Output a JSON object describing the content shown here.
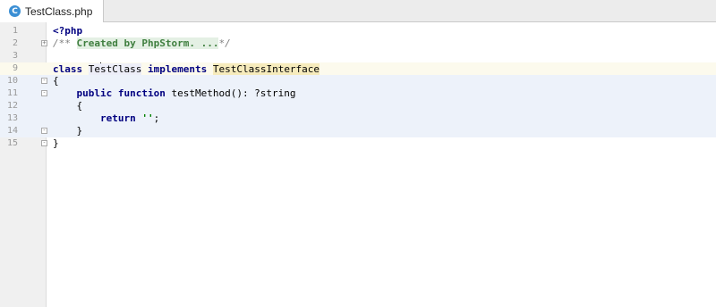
{
  "tab": {
    "icon_letter": "C",
    "title": "TestClass.php"
  },
  "editor": {
    "lines": [
      {
        "n": "1",
        "tokens": [
          {
            "t": "<?php",
            "c": "kw"
          }
        ]
      },
      {
        "n": "2",
        "tokens": [
          {
            "t": "/** ",
            "c": "cmt"
          },
          {
            "t": "Created by PhpStorm. ...",
            "c": "cmt-fold"
          },
          {
            "t": "*/",
            "c": "cmt"
          }
        ]
      },
      {
        "n": "3",
        "tokens": []
      },
      {
        "n": "9",
        "tokens": [
          {
            "t": "class ",
            "c": "kw"
          },
          {
            "t": "Te",
            "c": "cls"
          },
          {
            "t": "|",
            "c": "caret"
          },
          {
            "t": "stClass",
            "c": "cls"
          },
          {
            "t": " implements ",
            "c": "kw"
          },
          {
            "t": "TestClassInterface",
            "c": "iface"
          }
        ]
      },
      {
        "n": "10",
        "tokens": [
          {
            "t": "{",
            "c": ""
          }
        ]
      },
      {
        "n": "11",
        "tokens": [
          {
            "t": "    ",
            "c": ""
          },
          {
            "t": "public function ",
            "c": "kw"
          },
          {
            "t": "testMethod(): ?string",
            "c": ""
          }
        ]
      },
      {
        "n": "12",
        "tokens": [
          {
            "t": "    {",
            "c": ""
          }
        ]
      },
      {
        "n": "13",
        "tokens": [
          {
            "t": "        ",
            "c": ""
          },
          {
            "t": "return ",
            "c": "kw"
          },
          {
            "t": "''",
            "c": "str"
          },
          {
            "t": ";",
            "c": ""
          }
        ]
      },
      {
        "n": "14",
        "tokens": [
          {
            "t": "    }",
            "c": ""
          }
        ]
      },
      {
        "n": "15",
        "tokens": [
          {
            "t": "}",
            "c": ""
          }
        ]
      }
    ]
  }
}
